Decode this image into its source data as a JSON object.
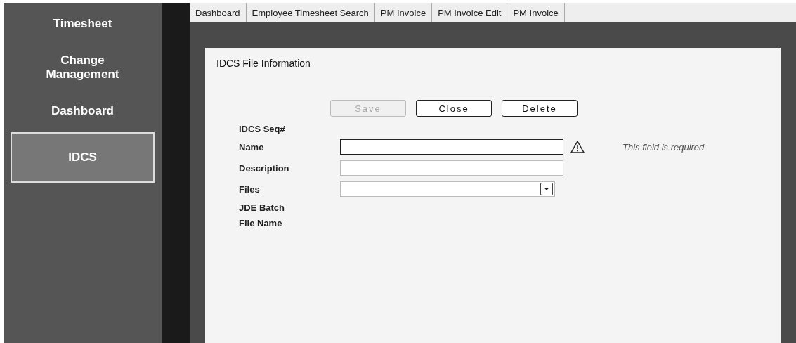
{
  "sidebar": {
    "items": [
      {
        "label": "Timesheet",
        "selected": false
      },
      {
        "label": "Change Management",
        "selected": false
      },
      {
        "label": "Dashboard",
        "selected": false
      },
      {
        "label": "IDCS",
        "selected": true
      }
    ]
  },
  "tabs": [
    {
      "label": "Dashboard",
      "selected": false
    },
    {
      "label": "Employee Timesheet Search",
      "selected": false
    },
    {
      "label": "PM Invoice",
      "selected": false
    },
    {
      "label": "PM Invoice Edit",
      "selected": false
    },
    {
      "label": "PM Invoice",
      "selected": false
    }
  ],
  "panel": {
    "title": "IDCS File Information",
    "buttons": [
      {
        "label": "Save",
        "disabled": true
      },
      {
        "label": "Close",
        "disabled": false
      },
      {
        "label": "Delete",
        "disabled": false
      }
    ],
    "fields": [
      {
        "label": "IDCS Seq#",
        "kind": "text"
      },
      {
        "label": "Name",
        "kind": "input",
        "required": true,
        "error": "This field is required"
      },
      {
        "label": "Description",
        "kind": "input",
        "required": false
      },
      {
        "label": "Files",
        "kind": "dropdown"
      },
      {
        "label": "JDE Batch",
        "kind": "text"
      },
      {
        "label": "File Name",
        "kind": "text"
      }
    ]
  }
}
